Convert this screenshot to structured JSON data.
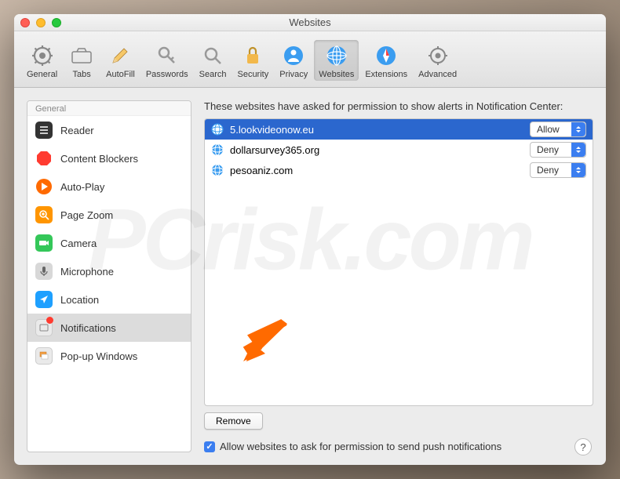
{
  "window": {
    "title": "Websites"
  },
  "toolbar": [
    {
      "key": "general",
      "label": "General"
    },
    {
      "key": "tabs",
      "label": "Tabs"
    },
    {
      "key": "autofill",
      "label": "AutoFill"
    },
    {
      "key": "passwords",
      "label": "Passwords"
    },
    {
      "key": "search",
      "label": "Search"
    },
    {
      "key": "security",
      "label": "Security"
    },
    {
      "key": "privacy",
      "label": "Privacy"
    },
    {
      "key": "websites",
      "label": "Websites",
      "selected": true
    },
    {
      "key": "extensions",
      "label": "Extensions"
    },
    {
      "key": "advanced",
      "label": "Advanced"
    }
  ],
  "sidebar": {
    "header": "General",
    "items": [
      {
        "key": "reader",
        "label": "Reader"
      },
      {
        "key": "contentblockers",
        "label": "Content Blockers"
      },
      {
        "key": "autoplay",
        "label": "Auto-Play"
      },
      {
        "key": "pagezoom",
        "label": "Page Zoom"
      },
      {
        "key": "camera",
        "label": "Camera"
      },
      {
        "key": "microphone",
        "label": "Microphone"
      },
      {
        "key": "location",
        "label": "Location"
      },
      {
        "key": "notifications",
        "label": "Notifications",
        "selected": true,
        "badge": true
      },
      {
        "key": "popup",
        "label": "Pop-up Windows"
      }
    ]
  },
  "main": {
    "heading": "These websites have asked for permission to show alerts in Notification Center:",
    "rows": [
      {
        "site": "5.lookvideonow.eu",
        "perm": "Allow",
        "selected": true
      },
      {
        "site": "dollarsurvey365.org",
        "perm": "Deny"
      },
      {
        "site": "pesoaniz.com",
        "perm": "Deny"
      }
    ],
    "remove_label": "Remove",
    "checkbox_label": "Allow websites to ask for permission to send push notifications",
    "checkbox_checked": true
  },
  "help": "?"
}
